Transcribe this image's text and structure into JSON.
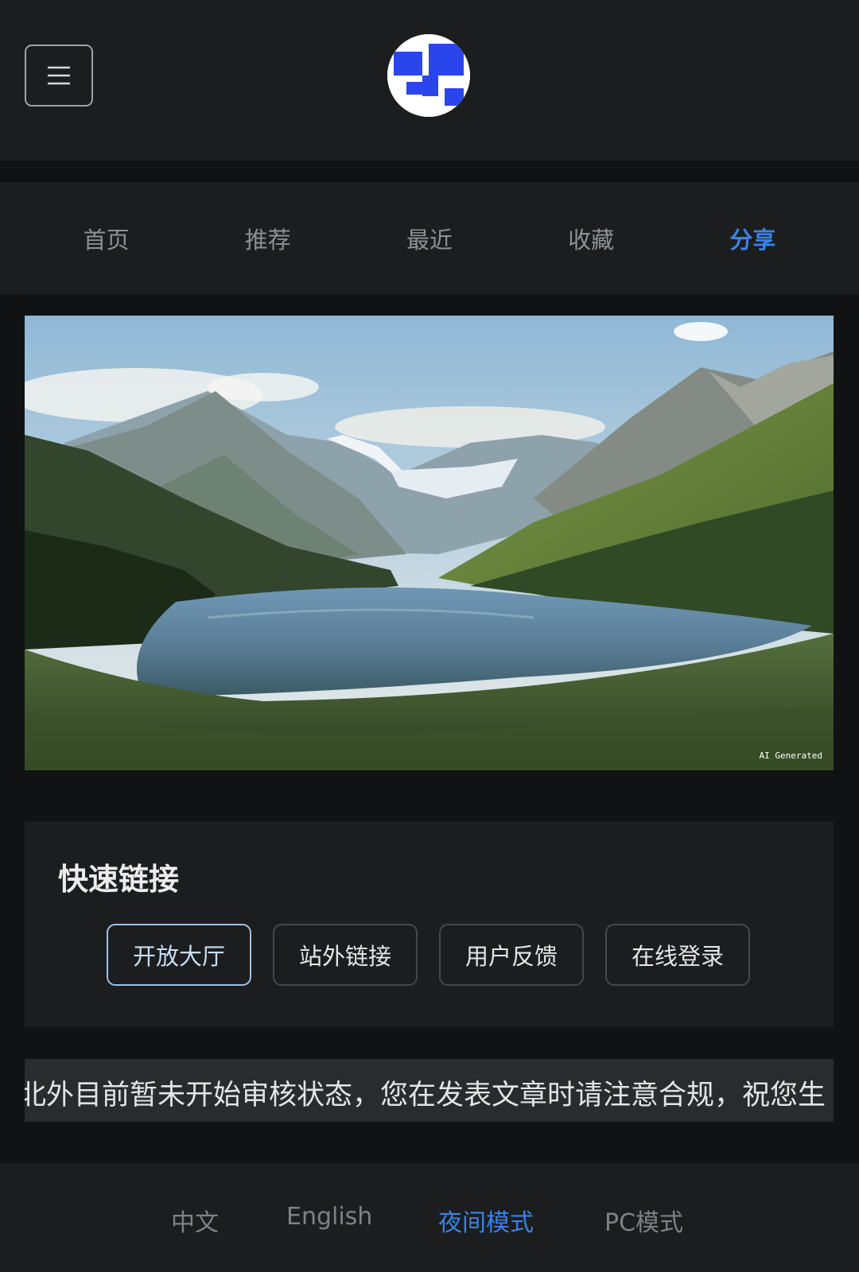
{
  "header": {
    "menu_icon": "hamburger-menu-icon",
    "logo_icon": "blue-white-checker-logo",
    "accent_color": "#2f4cf0"
  },
  "nav": {
    "tabs": [
      {
        "label": "首页",
        "active": false
      },
      {
        "label": "推荐",
        "active": false
      },
      {
        "label": "最近",
        "active": false
      },
      {
        "label": "收藏",
        "active": false
      },
      {
        "label": "分享",
        "active": true
      }
    ],
    "active_color": "#3b82e6"
  },
  "banner": {
    "watermark": "AI Generated"
  },
  "quick_links": {
    "title": "快速链接",
    "buttons": [
      {
        "label": "开放大厅",
        "active": true
      },
      {
        "label": "站外链接",
        "active": false
      },
      {
        "label": "用户反馈",
        "active": false
      },
      {
        "label": "在线登录",
        "active": false
      }
    ]
  },
  "marquee": {
    "text": "北外目前暂未开始审核状态，您在发表文章时请注意合规，祝您生"
  },
  "footer": {
    "items": [
      {
        "label": "中文",
        "active": false
      },
      {
        "label": "English",
        "active": false
      },
      {
        "label": "夜间模式",
        "active": true
      },
      {
        "label": "PC模式",
        "active": false
      }
    ]
  }
}
